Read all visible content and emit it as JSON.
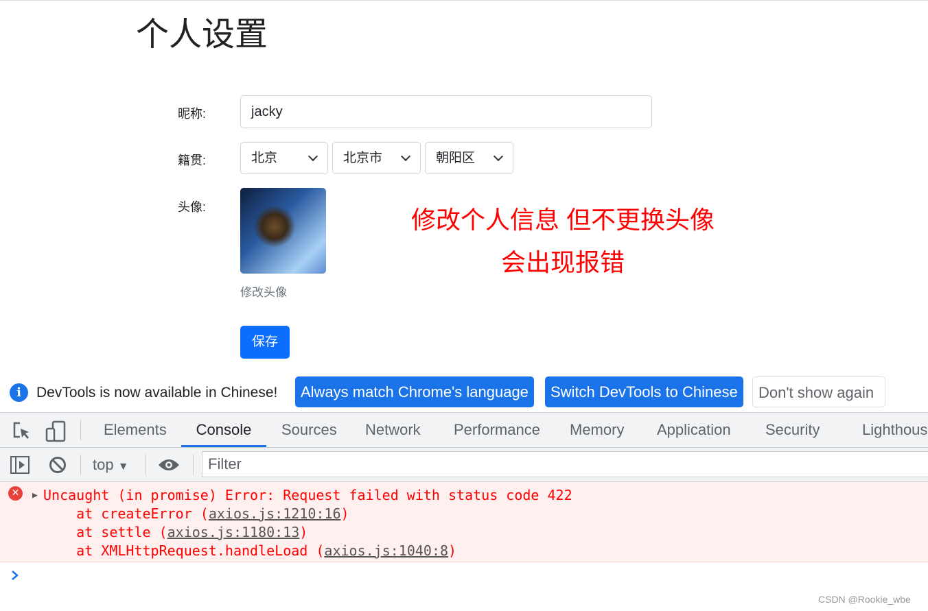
{
  "page": {
    "title": "个人设置",
    "nickname_label": "昵称:",
    "nickname_value": "jacky",
    "origin_label": "籍贯:",
    "province": "北京",
    "city": "北京市",
    "district": "朝阳区",
    "avatar_label": "头像:",
    "change_avatar": "修改头像",
    "save": "保存",
    "note_line1": "修改个人信息 但不更换头像",
    "note_line2": "会出现报错"
  },
  "devtools": {
    "banner_text": "DevTools is now available in Chinese!",
    "banner_buttons": [
      "Always match Chrome's language",
      "Switch DevTools to Chinese",
      "Don't show again"
    ],
    "tabs": [
      "Elements",
      "Console",
      "Sources",
      "Network",
      "Performance",
      "Memory",
      "Application",
      "Security",
      "Lighthous"
    ],
    "active_tab": "Console",
    "context": "top",
    "filter_placeholder": "Filter",
    "error": {
      "message": "Uncaught (in promise) Error: Request failed with status code 422",
      "stack": [
        {
          "prefix": "    at createError (",
          "link": "axios.js:1210:16",
          "suffix": ")"
        },
        {
          "prefix": "    at settle (",
          "link": "axios.js:1180:13",
          "suffix": ")"
        },
        {
          "prefix": "    at XMLHttpRequest.handleLoad (",
          "link": "axios.js:1040:8",
          "suffix": ")"
        }
      ]
    }
  },
  "watermark": "CSDN @Rookie_wbe",
  "colors": {
    "primary": "#0d6efd",
    "devtools_blue": "#1a73e8",
    "error": "#ff0000",
    "note": "#ff0000"
  }
}
